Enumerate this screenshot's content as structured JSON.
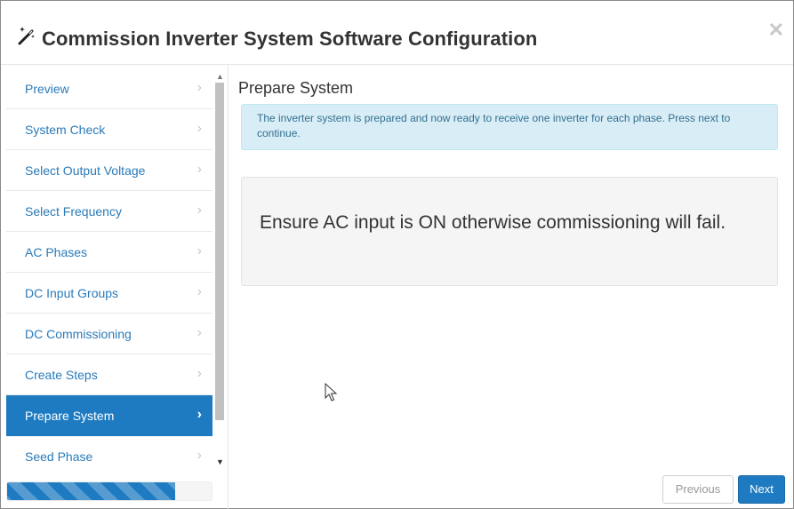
{
  "header": {
    "title": "Commission Inverter System Software Configuration",
    "icon": "magic-wand-icon",
    "close_icon": "close-icon"
  },
  "sidebar": {
    "items": [
      {
        "label": "Preview",
        "active": false
      },
      {
        "label": "System Check",
        "active": false
      },
      {
        "label": "Select Output Voltage",
        "active": false
      },
      {
        "label": "Select Frequency",
        "active": false
      },
      {
        "label": "AC Phases",
        "active": false
      },
      {
        "label": "DC Input Groups",
        "active": false
      },
      {
        "label": "DC Commissioning",
        "active": false
      },
      {
        "label": "Create Steps",
        "active": false
      },
      {
        "label": "Prepare System",
        "active": true
      },
      {
        "label": "Seed Phase",
        "active": false
      }
    ],
    "chevron": "›",
    "progress_fraction": 0.82
  },
  "content": {
    "step_title": "Prepare System",
    "info_message": "The inverter system is prepared and now ready to receive one inverter for each phase. Press next to continue.",
    "warning_message": "Ensure AC input is ON otherwise commissioning will fail."
  },
  "footer": {
    "previous_label": "Previous",
    "next_label": "Next"
  },
  "colors": {
    "accent": "#1f7bc1",
    "link": "#2a7ab8",
    "info_bg": "#d9edf7",
    "info_text": "#31708f"
  }
}
